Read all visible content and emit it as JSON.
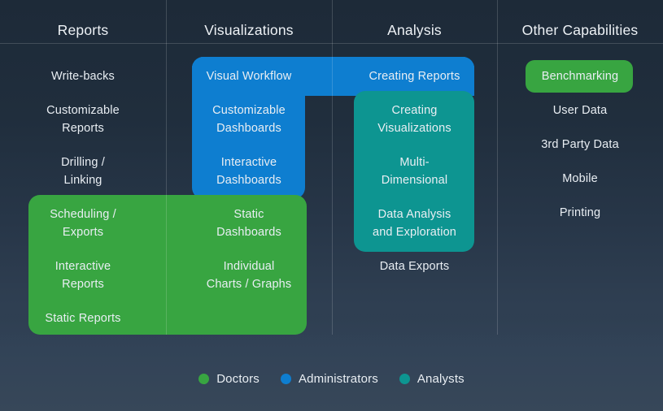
{
  "theme": {
    "bg_top": "#1d2a38",
    "bg_bottom": "#36465a",
    "divider": "rgba(255,255,255,0.16)",
    "text": "#e9eef3",
    "doctors_color": "#38a541",
    "administrators_color": "#0e7ed0",
    "analysts_color": "#0d9591"
  },
  "columns": [
    {
      "id": "reports",
      "title": "Reports"
    },
    {
      "id": "visualizations",
      "title": "Visualizations"
    },
    {
      "id": "analysis",
      "title": "Analysis"
    },
    {
      "id": "other",
      "title": "Other Capabilities"
    }
  ],
  "cells": {
    "reports": [
      "Write-backs",
      "Customizable\nReports",
      "Drilling /\nLinking",
      "Scheduling /\nExports",
      "Interactive\nReports",
      "Static Reports"
    ],
    "visualizations": [
      "Visual Workflow",
      "Customizable\nDashboards",
      "Interactive\nDashboards",
      "Static\nDashboards",
      "Individual\nCharts / Graphs"
    ],
    "analysis": [
      "Creating Reports",
      "Creating\nVisualizations",
      "Multi-\nDimensional",
      "Data Analysis\nand Exploration",
      "Data Exports"
    ],
    "other": [
      "Benchmarking",
      "User Data",
      "3rd Party Data",
      "Mobile",
      "Printing"
    ]
  },
  "items": {
    "write_backs": "Write-backs",
    "customizable_reports_l1": "Customizable",
    "customizable_reports_l2": "Reports",
    "drilling_l1": "Drilling /",
    "drilling_l2": "Linking",
    "scheduling_l1": "Scheduling /",
    "scheduling_l2": "Exports",
    "interactive_reports_l1": "Interactive",
    "interactive_reports_l2": "Reports",
    "static_reports": "Static Reports",
    "visual_workflow": "Visual Workflow",
    "customizable_dash_l1": "Customizable",
    "customizable_dash_l2": "Dashboards",
    "interactive_dash_l1": "Interactive",
    "interactive_dash_l2": "Dashboards",
    "static_dash_l1": "Static",
    "static_dash_l2": "Dashboards",
    "individual_charts_l1": "Individual",
    "individual_charts_l2": "Charts / Graphs",
    "creating_reports": "Creating Reports",
    "creating_vis_l1": "Creating",
    "creating_vis_l2": "Visualizations",
    "multi_dim_l1": "Multi-",
    "multi_dim_l2": "Dimensional",
    "data_analysis_l1": "Data Analysis",
    "data_analysis_l2": "and Exploration",
    "data_exports": "Data Exports",
    "benchmarking": "Benchmarking",
    "user_data": "User Data",
    "third_party_data": "3rd Party Data",
    "mobile": "Mobile",
    "printing": "Printing"
  },
  "legend": [
    {
      "label": "Doctors",
      "color": "#38a541"
    },
    {
      "label": "Administrators",
      "color": "#0e7ed0"
    },
    {
      "label": "Analysts",
      "color": "#0d9591"
    }
  ]
}
